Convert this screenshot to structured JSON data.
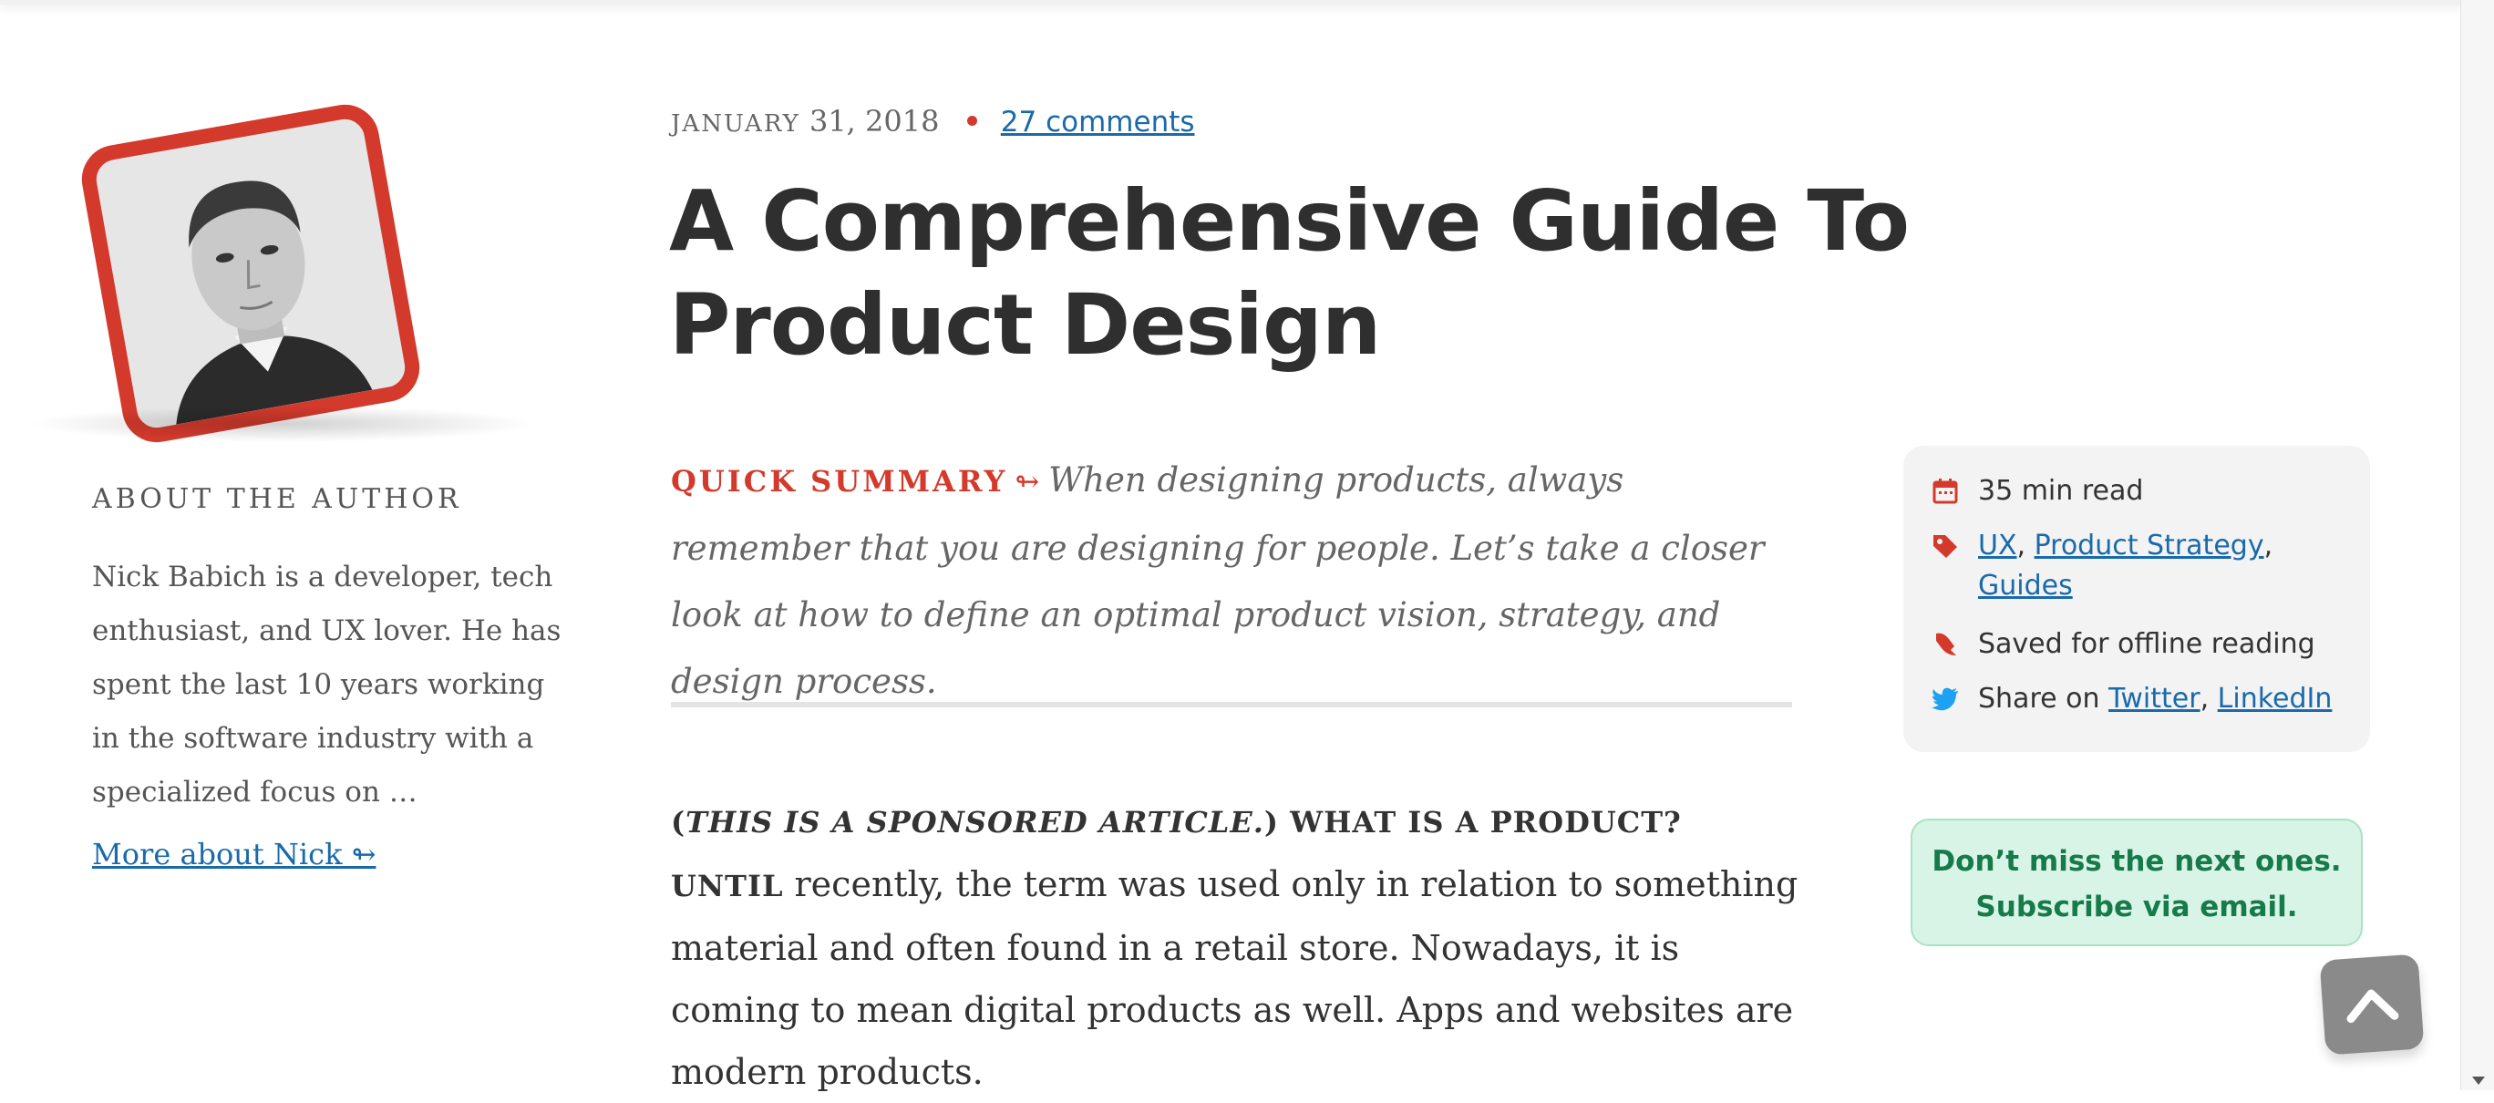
{
  "author": {
    "about_label": "About The Author",
    "bio": "Nick Babich is a developer, tech enthusiast, and UX lover. He has spent the last 10 years working in the software industry with a specialized focus on …",
    "more_link": "More about Nick ↬"
  },
  "meta": {
    "month": "January",
    "day_year": "31, 2018",
    "comments": "27 comments"
  },
  "article": {
    "title": "A Comprehensive Guide To Product Design",
    "summary_label": "Quick Summary",
    "summary_arrow": "↬",
    "summary_text": "When designing products, always remember that you are designing for people. Let’s take a closer look at how to define an optimal product vision, strategy, and design process.",
    "body_open_paren": "(",
    "body_sponsored": "This is a sponsored article.",
    "body_close_paren": ")",
    "body_caps": " What is a product? Until",
    "body_rest": " recently, the term was used only in relation to something material and often found in a retail store. Nowadays, it is coming to mean digital products as well. Apps and websites are modern products."
  },
  "info_box": {
    "read_time": "35 min read",
    "tags": [
      "UX",
      "Product Strategy",
      "Guides"
    ],
    "saved": "Saved for offline reading",
    "share_prefix": "Share on",
    "share_links": [
      "Twitter",
      "LinkedIn"
    ]
  },
  "newsletter": {
    "line1": "Don’t miss the next ones.",
    "line2": "Subscribe via email."
  },
  "colors": {
    "accent_red": "#d33a2c",
    "link_blue": "#1a6aab",
    "newsletter_green": "#167a4a",
    "twitter_blue": "#1da1f2"
  },
  "icons": [
    "calendar-icon",
    "tag-icon",
    "bookmark-icon",
    "twitter-icon",
    "chevron-up-icon"
  ]
}
